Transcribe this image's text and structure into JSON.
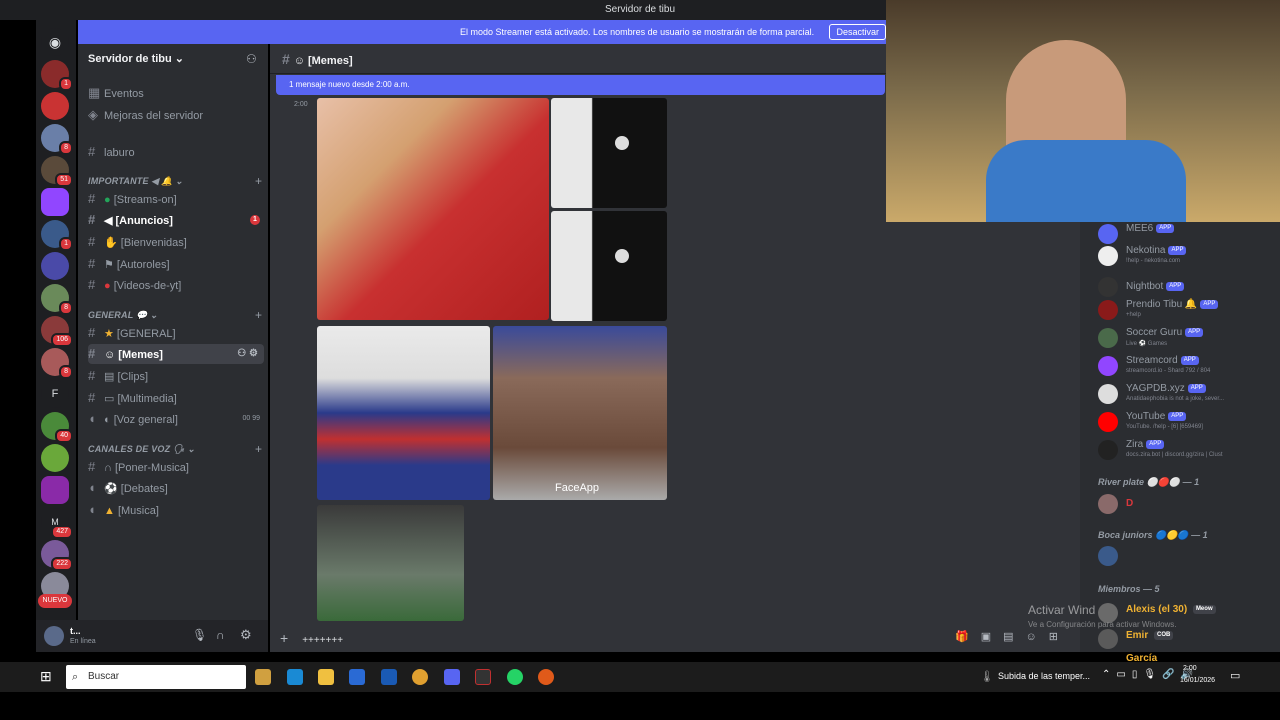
{
  "window": {
    "title": "Servidor de tibu"
  },
  "banner": {
    "text": "El modo Streamer está activado. Los nombres de usuario se mostrarán de forma parcial.",
    "button": "Desactivar"
  },
  "guild_badges": [
    "1",
    "8",
    "51",
    "1",
    "8",
    "106",
    "8",
    "40",
    "427",
    "222",
    "NUEVO"
  ],
  "guild_letters": [
    "F",
    "M"
  ],
  "server": {
    "name": "Servidor de tibu ⌄"
  },
  "menu": {
    "events": "Eventos",
    "boosts": "Mejoras del servidor",
    "laburo": "laburo"
  },
  "categories": {
    "important": "IMPORTANTE ◀ 🔔 ⌄",
    "general": "GENERAL 💬 ⌄",
    "voice": "CANALES DE VOZ 🗣 ⌄"
  },
  "channels": {
    "important": [
      "[Streams-on]",
      "[Anuncios]",
      "[Bienvenidas]",
      "[Autoroles]",
      "[Videos-de-yt]"
    ],
    "general": [
      "[GENERAL]",
      "[Memes]",
      "[Clips]",
      "[Multimedia]",
      "[Voz general]"
    ],
    "voice": [
      "[Poner-Musica]",
      "[Debates]",
      "[Musica]"
    ]
  },
  "anuncios_badge": "1",
  "voz_counts": "00  99",
  "chat": {
    "channel": "[Memes]",
    "new_messages": "1 mensaje nuevo desde 2:00 a.m.",
    "time": "2:00",
    "faceapp": "FaceApp",
    "composer": "+++++++"
  },
  "user": {
    "name": "t...",
    "status": "En línea"
  },
  "members": {
    "bots": [
      {
        "name": "MEE6",
        "sub": ""
      },
      {
        "name": "Nekotina",
        "sub": "!help - nekotina.com"
      },
      {
        "name": "Nightbot",
        "sub": ""
      },
      {
        "name": "Prendio Tibu 🔔",
        "sub": "+help"
      },
      {
        "name": "Soccer Guru",
        "sub": "Live ⚽ Games"
      },
      {
        "name": "Streamcord",
        "sub": "streamcord.io - Shard 792 / 804"
      },
      {
        "name": "YAGPDB.xyz",
        "sub": "Anatidaephobia is not a joke, sever..."
      },
      {
        "name": "YouTube",
        "sub": "YouTube. /help - [6] [659469]"
      },
      {
        "name": "Zira",
        "sub": "docs.zira.bot | discord.gg/zira | Clust"
      }
    ],
    "app_label": "APP",
    "river": "River plate ⚪🔴⚪ — 1",
    "river_member": "D",
    "boca": "Boca juniors 🔵🟡🔵 — 1",
    "miembros": "Miembros — 5",
    "m1": "Alexis (el 30)",
    "m1_tag": "Meow",
    "m2": "Emir",
    "m2_tag": "COB",
    "m3": "García"
  },
  "watermark": {
    "line1": "Activar Wind",
    "line2": "Ve a Configuración para activar Windows."
  },
  "taskbar": {
    "search": "Buscar",
    "weather": "Subida de las temper...",
    "time": "2:00",
    "date": "16/01/2026"
  }
}
